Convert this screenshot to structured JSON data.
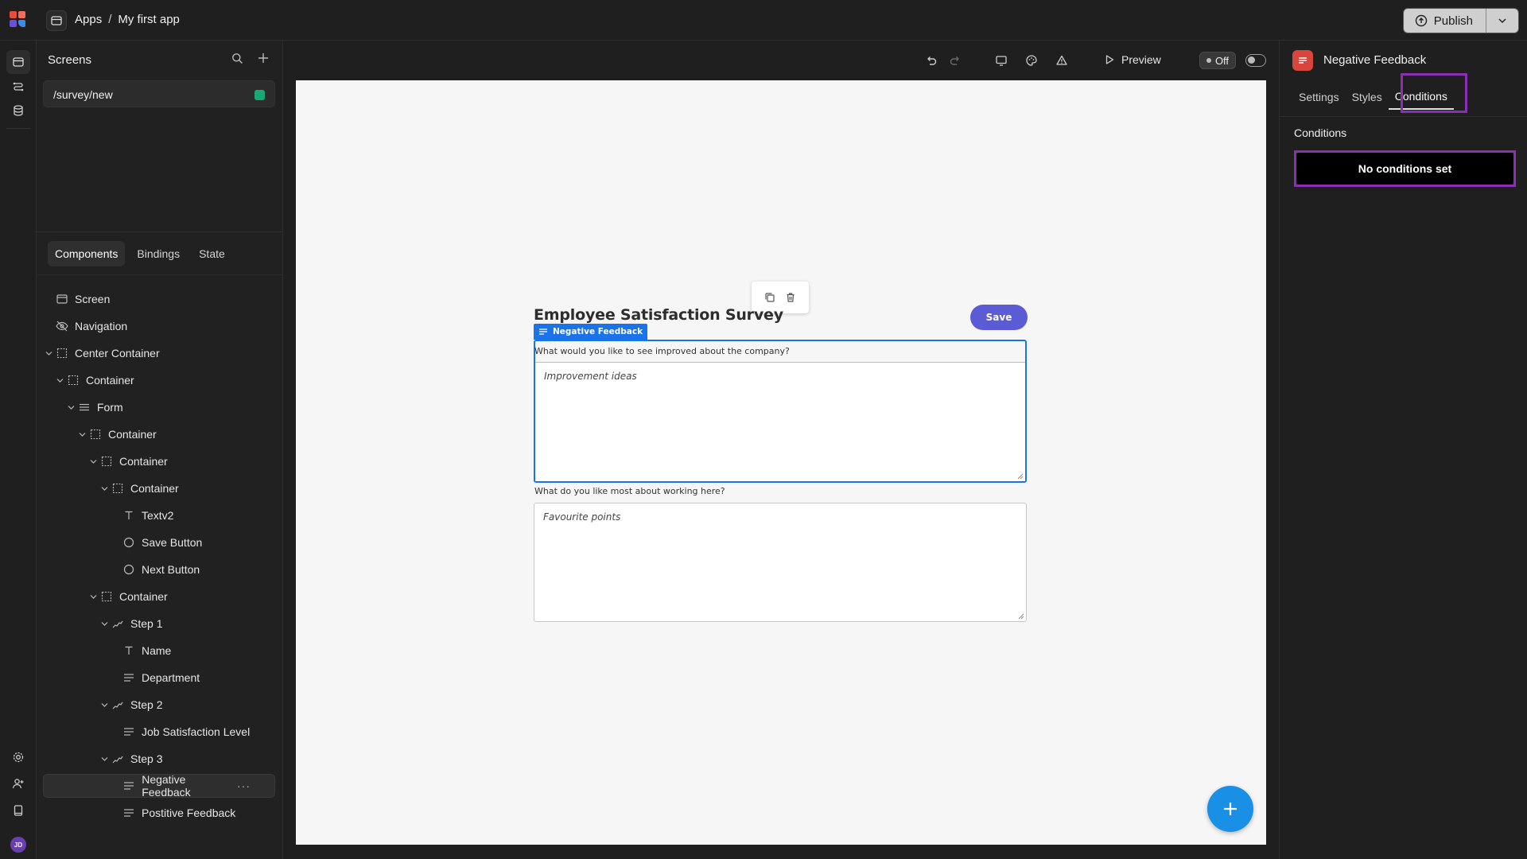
{
  "topbar": {
    "breadcrumb": [
      "Apps",
      "My first app"
    ],
    "separator": "/",
    "publish_label": "Publish"
  },
  "screens": {
    "header": "Screens",
    "items": [
      {
        "path": "/survey/new",
        "status_color": "#19a974"
      }
    ]
  },
  "left_tabs": [
    "Components",
    "Bindings",
    "State"
  ],
  "tree": [
    {
      "label": "Screen",
      "icon": "screen-icon"
    },
    {
      "label": "Navigation",
      "icon": "eye-off-icon"
    },
    {
      "label": "Center Container",
      "icon": "container-icon"
    },
    {
      "label": "Container",
      "icon": "container-icon"
    },
    {
      "label": "Form",
      "icon": "form-icon"
    },
    {
      "label": "Container",
      "icon": "container-icon"
    },
    {
      "label": "Container",
      "icon": "container-icon"
    },
    {
      "label": "Container",
      "icon": "container-icon"
    },
    {
      "label": "Textv2",
      "icon": "text-icon"
    },
    {
      "label": "Save Button",
      "icon": "button-icon"
    },
    {
      "label": "Next Button",
      "icon": "button-icon"
    },
    {
      "label": "Container",
      "icon": "container-icon"
    },
    {
      "label": "Step 1",
      "icon": "step-icon"
    },
    {
      "label": "Name",
      "icon": "text-icon"
    },
    {
      "label": "Department",
      "icon": "list-icon"
    },
    {
      "label": "Step 2",
      "icon": "step-icon"
    },
    {
      "label": "Job Satisfaction Level",
      "icon": "list-icon"
    },
    {
      "label": "Step 3",
      "icon": "step-icon"
    },
    {
      "label": "Negative Feedback",
      "icon": "list-icon",
      "selected": true,
      "more": "···"
    },
    {
      "label": "Postitive Feedback",
      "icon": "list-icon"
    }
  ],
  "toolbar": {
    "preview_label": "Preview",
    "off_label": "Off"
  },
  "canvas": {
    "title": "Employee Satisfaction Survey",
    "save_label": "Save",
    "selected_badge": "Negative Feedback",
    "field1": {
      "label": "What would you like to see improved about the company?",
      "placeholder": "Improvement ideas"
    },
    "field2": {
      "label": "What do you like most about working here?",
      "placeholder": "Favourite points"
    }
  },
  "rightpanel": {
    "title": "Negative Feedback",
    "tabs": [
      "Settings",
      "Styles",
      "Conditions"
    ],
    "active_tab": "Conditions",
    "section": "Conditions",
    "empty_label": "No conditions set"
  },
  "user": {
    "initials": "JD"
  },
  "colors": {
    "accent": "#5b5bd6",
    "selection": "#1a73e8",
    "highlight": "#8a2fb5",
    "fab": "#1a8fe6",
    "component_icon": "#d8453a"
  }
}
